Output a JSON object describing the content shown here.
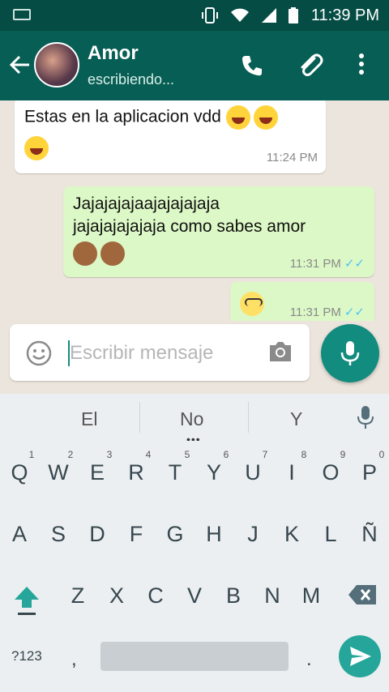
{
  "status_bar": {
    "time": "11:39 PM"
  },
  "header": {
    "contact_name": "Amor",
    "contact_status": "escribiendo..."
  },
  "messages": [
    {
      "direction": "in",
      "text": "Estas en la aplicacion vdd",
      "emoji_line1": [
        "laugh",
        "laugh"
      ],
      "emoji_line2": [
        "laugh"
      ],
      "time": "11:24 PM"
    },
    {
      "direction": "out",
      "line1": "Jajajajajaajajajajaja",
      "line2": "jajajajajajaja como sabes amor",
      "emoji": [
        "see-no-evil-monkey",
        "see-no-evil-monkey"
      ],
      "time": "11:31 PM"
    },
    {
      "direction": "out",
      "emoji": [
        "face-with-rolling-eyes"
      ],
      "time": "11:31 PM"
    }
  ],
  "composer": {
    "placeholder": "Escribir mensaje"
  },
  "suggestions": [
    "El",
    "No",
    "Y"
  ],
  "keyboard": {
    "row1": [
      "Q",
      "W",
      "E",
      "R",
      "T",
      "Y",
      "U",
      "I",
      "O",
      "P"
    ],
    "row1_hints": [
      "1",
      "2",
      "3",
      "4",
      "5",
      "6",
      "7",
      "8",
      "9",
      "0"
    ],
    "row2": [
      "A",
      "S",
      "D",
      "F",
      "G",
      "H",
      "J",
      "K",
      "L",
      "Ñ"
    ],
    "row3": [
      "Z",
      "X",
      "C",
      "V",
      "B",
      "N",
      "M"
    ],
    "symbols_key": "?123",
    "comma": ",",
    "period": "."
  },
  "colors": {
    "header": "#075e54",
    "status_bar": "#054d44",
    "accent": "#128c7e",
    "outgoing_bubble": "#dcf8c6",
    "read_ticks": "#4fc3f7"
  }
}
